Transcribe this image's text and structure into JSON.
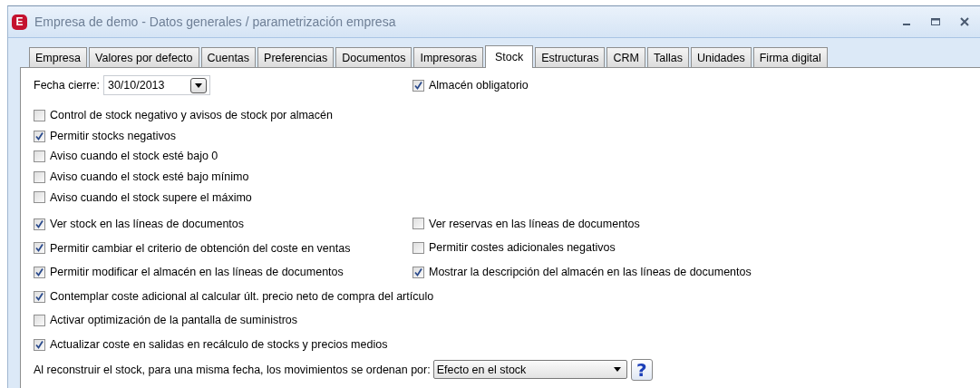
{
  "window": {
    "title": "Empresa de demo - Datos generales / parametrización empresa",
    "app_letter": "E"
  },
  "tabs": [
    {
      "label": "Empresa",
      "selected": false
    },
    {
      "label": "Valores por defecto",
      "selected": false
    },
    {
      "label": "Cuentas",
      "selected": false
    },
    {
      "label": "Preferencias",
      "selected": false
    },
    {
      "label": "Documentos",
      "selected": false
    },
    {
      "label": "Impresoras",
      "selected": false
    },
    {
      "label": "Stock",
      "selected": true
    },
    {
      "label": "Estructuras",
      "selected": false
    },
    {
      "label": "CRM",
      "selected": false
    },
    {
      "label": "Tallas",
      "selected": false
    },
    {
      "label": "Unidades",
      "selected": false
    },
    {
      "label": "Firma digital",
      "selected": false
    }
  ],
  "closing_date": {
    "label": "Fecha cierre:",
    "value": "30/10/2013"
  },
  "warehouse_required": {
    "label": "Almacén obligatorio",
    "checked": true
  },
  "groups": [
    {
      "rows": [
        [
          {
            "label": "Control de stock negativo y avisos de stock por almacén",
            "checked": false
          }
        ],
        [
          {
            "label": "Permitir stocks negativos",
            "checked": true
          }
        ],
        [
          {
            "label": "Aviso cuando el stock esté bajo 0",
            "checked": false
          }
        ],
        [
          {
            "label": "Aviso cuando el stock esté bajo mínimo",
            "checked": false
          }
        ],
        [
          {
            "label": "Aviso cuando el stock supere el máximo",
            "checked": false
          }
        ]
      ]
    },
    {
      "rows": [
        [
          {
            "label": "Ver stock en las líneas de documentos",
            "checked": true
          },
          {
            "label": "Ver reservas en las líneas de documentos",
            "checked": false
          }
        ],
        [
          {
            "label": "Permitir cambiar el criterio de obtención del coste en ventas",
            "checked": true
          },
          {
            "label": "Permitir costes adicionales negativos",
            "checked": false
          }
        ],
        [
          {
            "label": "Permitir modificar el almacén en las líneas de documentos",
            "checked": true
          },
          {
            "label": "Mostrar la descripción del almacén en las  líneas de documentos",
            "checked": true
          }
        ],
        [
          {
            "label": "Contemplar coste adicional al calcular últ. precio neto de compra del artículo",
            "checked": true
          }
        ],
        [
          {
            "label": "Activar optimización de la pantalla de suministros",
            "checked": false
          }
        ],
        [
          {
            "label": "Actualizar coste en salidas en recálculo de stocks y precios medios",
            "checked": true
          }
        ]
      ]
    }
  ],
  "rebuild_order": {
    "label": "Al reconstruir el stock, para una misma fecha, los movimientos se ordenan por:",
    "value": "Efecto en el stock",
    "help": "?"
  }
}
